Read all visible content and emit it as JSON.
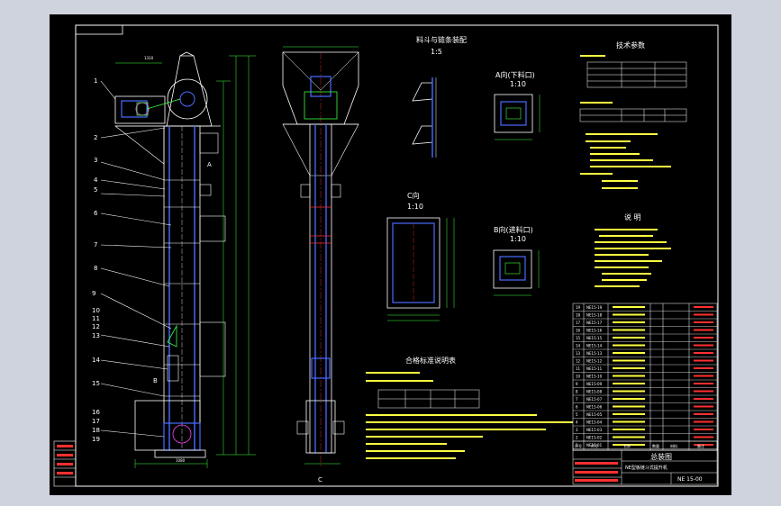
{
  "drawing": {
    "part_labels": [
      "1",
      "2",
      "3",
      "4",
      "5",
      "6",
      "7",
      "8",
      "9",
      "10",
      "11",
      "12",
      "13",
      "14",
      "15",
      "16",
      "17",
      "18",
      "19"
    ],
    "views": {
      "view_a": "A向(下料口)",
      "view_a_scale": "1:10",
      "view_b": "B向(进料口)",
      "view_b_scale": "1:10",
      "view_c": "C向",
      "view_c_scale": "1:10",
      "bucket_detail": "料斗与链条装配",
      "bucket_scale": "1:5",
      "section_a_mark": "A",
      "section_b_mark": "B",
      "section_c_mark": "C"
    },
    "tech_title": "技术参数",
    "notes_title": "说 明",
    "table2_title": "合格标准说明表",
    "title_block": {
      "name": "总装图",
      "drawing_no": "NE 15-00",
      "project": "NE型板链斗式提升机",
      "header_cols": [
        "序号",
        "代号",
        "名称",
        "数量",
        "材料",
        "备注"
      ]
    },
    "bom_codes": [
      "NE15-01",
      "NE15-02",
      "NE15-03",
      "NE15-04",
      "NE15-05",
      "NE15-06",
      "NE15-07",
      "NE15-08",
      "NE15-09",
      "NE15-10",
      "NE15-11",
      "NE15-12",
      "NE15-13",
      "NE15-14",
      "NE15-15",
      "NE15-16",
      "NE15-17",
      "NE15-18",
      "NE15-19"
    ]
  }
}
